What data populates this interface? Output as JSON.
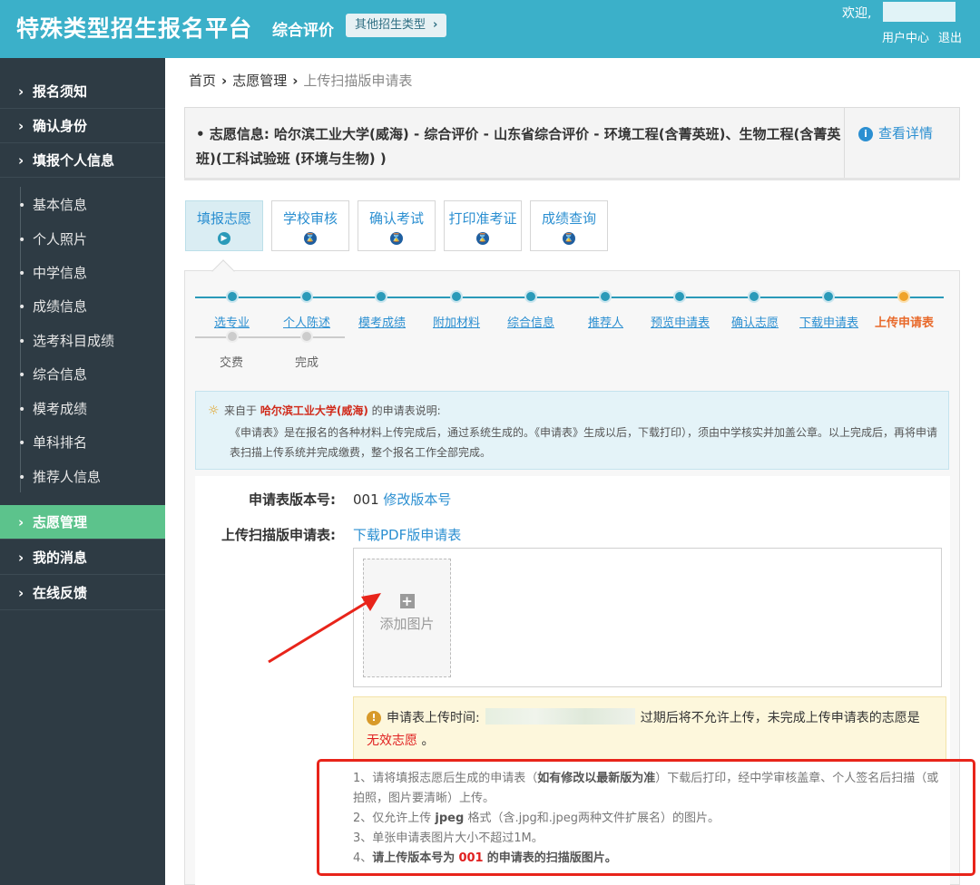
{
  "header": {
    "brand": "特殊类型招生报名平台",
    "subtitle": "综合评价",
    "type_button": "其他招生类型",
    "welcome": "欢迎,",
    "user_center": "用户中心",
    "logout": "退出"
  },
  "sidebar": {
    "top_items": [
      {
        "label": "报名须知"
      },
      {
        "label": "确认身份"
      },
      {
        "label": "填报个人信息"
      }
    ],
    "sub_items": [
      {
        "label": "基本信息"
      },
      {
        "label": "个人照片"
      },
      {
        "label": "中学信息"
      },
      {
        "label": "成绩信息"
      },
      {
        "label": "选考科目成绩"
      },
      {
        "label": "综合信息"
      },
      {
        "label": "模考成绩"
      },
      {
        "label": "单科排名"
      },
      {
        "label": "推荐人信息"
      }
    ],
    "bottom_items": [
      {
        "label": "志愿管理",
        "active": true
      },
      {
        "label": "我的消息"
      },
      {
        "label": "在线反馈"
      }
    ]
  },
  "breadcrumb": {
    "home": "首页",
    "section": "志愿管理",
    "current": "上传扫描版申请表"
  },
  "info": {
    "text": "志愿信息: 哈尔滨工业大学(威海) - 综合评价 - 山东省综合评价 - 环境工程(含菁英班)、生物工程(含菁英班)(工科试验班 (环境与生物) )",
    "detail_link": "查看详情"
  },
  "tabs": [
    {
      "label": "填报志愿",
      "active": true
    },
    {
      "label": "学校审核"
    },
    {
      "label": "确认考试"
    },
    {
      "label": "打印准考证"
    },
    {
      "label": "成绩查询"
    }
  ],
  "steps": [
    {
      "label": "选专业"
    },
    {
      "label": "个人陈述"
    },
    {
      "label": "模考成绩"
    },
    {
      "label": "附加材料"
    },
    {
      "label": "综合信息"
    },
    {
      "label": "推荐人"
    },
    {
      "label": "预览申请表"
    },
    {
      "label": "确认志愿"
    },
    {
      "label": "下载申请表"
    },
    {
      "label": "上传申请表",
      "current": true
    }
  ],
  "steps_pending": [
    {
      "label": "交费"
    },
    {
      "label": "完成"
    }
  ],
  "notice": {
    "prefix": "来自于",
    "school": "哈尔滨工业大学(威海)",
    "suffix": "的申请表说明:",
    "body": "《申请表》是在报名的各种材料上传完成后，通过系统生成的。《申请表》生成以后，下载打印），须由中学核实并加盖公章。以上完成后，再将申请表扫描上传系统并完成缴费，整个报名工作全部完成。"
  },
  "form": {
    "version_label": "申请表版本号:",
    "version_value": "001",
    "version_link": "修改版本号",
    "upload_label": "上传扫描版申请表:",
    "download_link": "下载PDF版申请表",
    "add_image": "添加图片"
  },
  "warning": {
    "prefix": "申请表上传时间:",
    "middle": "过期后将不允许上传，未完成上传申请表的志愿是",
    "red_part": "无效志愿",
    "end": "。"
  },
  "rules": {
    "r1_a": "1、请将填报志愿后生成的申请表（",
    "r1_b": "如有修改以最新版为准",
    "r1_c": "）下载后打印，经中学审核盖章、个人签名后扫描（或拍照，图片要清晰）上传。",
    "r2_a": "2、仅允许上传",
    "r2_b": "jpeg",
    "r2_c": "格式（含.jpg和.jpeg两种文件扩展名）的图片。",
    "r3": "3、单张申请表图片大小不超过1M。",
    "r4_a": "4、",
    "r4_b": "请上传版本号为",
    "r4_c": "001",
    "r4_d": "的申请表的扫描版图片。"
  },
  "colors": {
    "header_bg": "#3bb0c9",
    "sidebar_bg": "#2e3b44",
    "active_menu": "#5cc38c",
    "link": "#2b8fd1",
    "current_step": "#e8692a",
    "highlight_red": "#e8241a"
  }
}
